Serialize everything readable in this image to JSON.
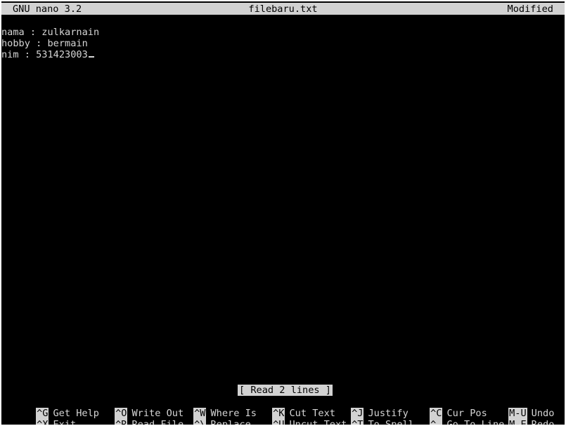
{
  "header": {
    "app": "GNU nano 3.2",
    "filename": "filebaru.txt",
    "state": "Modified"
  },
  "editor": {
    "lines": [
      "nama : zulkarnain",
      "hobby : bermain",
      "nim : 531423003"
    ]
  },
  "status": "[ Read 2 lines ]",
  "shortcuts": {
    "get_help": {
      "key": "^G",
      "label": "Get Help"
    },
    "exit": {
      "key": "^X",
      "label": "Exit"
    },
    "write_out": {
      "key": "^O",
      "label": "Write Out"
    },
    "read_file": {
      "key": "^R",
      "label": "Read File"
    },
    "where_is": {
      "key": "^W",
      "label": "Where Is"
    },
    "replace": {
      "key": "^\\",
      "label": "Replace"
    },
    "cut_text": {
      "key": "^K",
      "label": "Cut Text"
    },
    "uncut_text": {
      "key": "^U",
      "label": "Uncut Text"
    },
    "justify": {
      "key": "^J",
      "label": "Justify"
    },
    "to_spell": {
      "key": "^T",
      "label": "To Spell"
    },
    "cur_pos": {
      "key": "^C",
      "label": "Cur Pos"
    },
    "go_to_line": {
      "key": "^_",
      "label": "Go To Line"
    },
    "undo": {
      "key": "M-U",
      "label": "Undo"
    },
    "redo": {
      "key": "M-E",
      "label": "Redo"
    }
  }
}
